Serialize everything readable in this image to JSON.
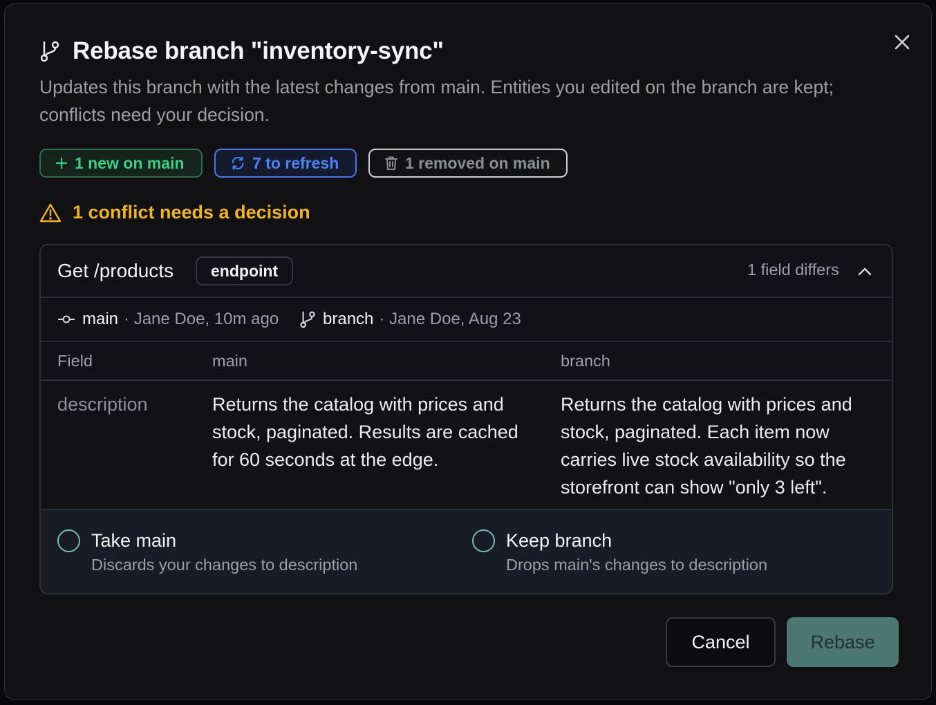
{
  "dialog": {
    "title": "Rebase branch \"inventory-sync\"",
    "subtitle": "Updates this branch with the latest changes from main. Entities you edited on the branch are kept; conflicts need your decision.",
    "close_icon": "close-icon",
    "title_icon": "git-branch-icon"
  },
  "chips": {
    "new": {
      "label": "1 new on main",
      "icon": "plus-icon",
      "color": "#3ecf86"
    },
    "refresh": {
      "label": "7 to refresh",
      "icon": "refresh-icon",
      "color": "#4f83f5"
    },
    "removed": {
      "label": "1 removed on main",
      "icon": "trash-icon",
      "color": "#8d8d96"
    }
  },
  "warning": {
    "text": "1 conflict needs a decision",
    "icon": "warning-icon",
    "color": "#efb32b"
  },
  "conflict": {
    "entity": "Get /products",
    "entity_type": "endpoint",
    "field_differs": "1 field differs",
    "main_meta": {
      "label": "main",
      "author": "· Jane Doe, 10m ago",
      "icon": "commit-icon"
    },
    "branch_meta": {
      "label": "branch",
      "author": "· Jane Doe, Aug 23",
      "icon": "git-branch-icon"
    },
    "columns": [
      "Field",
      "main",
      "branch"
    ],
    "row": {
      "field": "description",
      "main": "Returns the catalog with prices and stock, paginated. Results are cached for 60 seconds at the edge.",
      "branch": "Returns the catalog with prices and stock, paginated. Each item now carries live stock availability so the storefront can show \"only 3 left\"."
    },
    "options": [
      {
        "title": "Take main",
        "description": "Discards your changes to description"
      },
      {
        "title": "Keep branch",
        "description": "Drops main's changes to description"
      }
    ]
  },
  "footer": {
    "cancel_label": "Cancel",
    "rebase_label": "Rebase",
    "accent": "#4d7773"
  }
}
